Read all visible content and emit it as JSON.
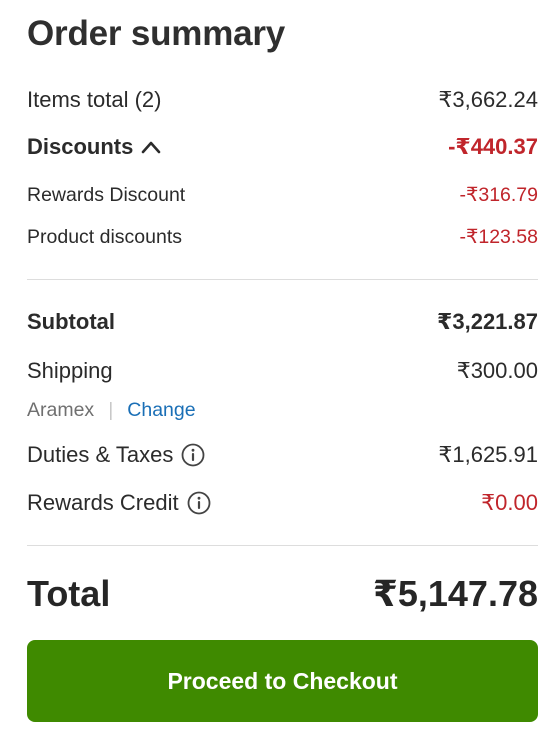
{
  "order_summary": {
    "title": "Order summary",
    "items_total": {
      "label": "Items total (2)",
      "value": "₹3,662.24"
    },
    "discounts": {
      "label": "Discounts",
      "value": "-₹440.37",
      "expanded": true,
      "breakdown": [
        {
          "label": "Rewards Discount",
          "value": "-₹316.79"
        },
        {
          "label": "Product discounts",
          "value": "-₹123.58"
        }
      ]
    },
    "subtotal": {
      "label": "Subtotal",
      "value": "₹3,221.87"
    },
    "shipping": {
      "label": "Shipping",
      "value": "₹300.00",
      "carrier": "Aramex",
      "separator": "|",
      "change_link": "Change"
    },
    "duties_taxes": {
      "label": "Duties & Taxes",
      "value": "₹1,625.91",
      "icon": "info-icon"
    },
    "rewards_credit": {
      "label": "Rewards Credit",
      "value": "₹0.00",
      "icon": "info-icon"
    },
    "total": {
      "label": "Total",
      "value": "₹5,147.78"
    },
    "checkout_button": "Proceed to Checkout"
  },
  "colors": {
    "negative": "#c0252b",
    "link": "#1a6fb6",
    "button": "#3f8a00",
    "text": "#2b2b2b"
  }
}
